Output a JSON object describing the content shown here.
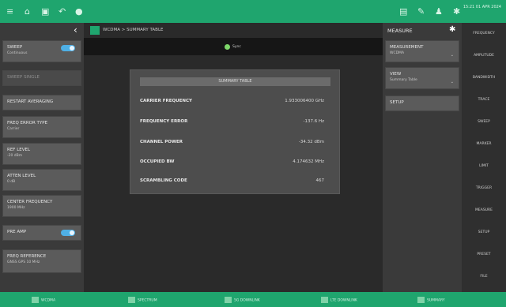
{
  "topbar": {
    "icons": [
      "menu-icon",
      "home-icon",
      "save-icon",
      "undo-icon",
      "pin-icon"
    ],
    "right_icons": [
      "screen-icon",
      "tools-icon",
      "user-icon",
      "gear-icon"
    ],
    "clock": "15:21 01 APR 2024"
  },
  "left_panel": {
    "collapse_icon": "chevron-left-icon",
    "items": [
      {
        "label": "SWEEP",
        "sub": "Continuous",
        "toggle": true
      },
      {
        "label": "SWEEP SINGLE",
        "sub": ""
      },
      {
        "label": "RESTART AVERAGING",
        "sub": ""
      },
      {
        "label": "FREQ ERROR TYPE",
        "sub": "Carrier"
      },
      {
        "label": "REF LEVEL",
        "sub": "-20 dBm"
      },
      {
        "label": "ATTEN LEVEL",
        "sub": "0 dB"
      },
      {
        "label": "CENTER FREQUENCY",
        "sub": "1900 MHz"
      },
      {
        "label": "PRE AMP",
        "sub": "",
        "toggle": true
      },
      {
        "label": "FREQ REFERENCE",
        "sub": "GNSS GPS 10 MHz"
      }
    ]
  },
  "center": {
    "title": "WCDMA > SUMMARY TABLE",
    "sync_text": "Sync",
    "summary": {
      "header": "SUMMARY TABLE",
      "rows": [
        {
          "label": "CARRIER FREQUENCY",
          "value": "1.933006400 GHz"
        },
        {
          "label": "FREQUENCY ERROR",
          "value": "-137.6 Hz"
        },
        {
          "label": "CHANNEL POWER",
          "value": "-34.32 dBm"
        },
        {
          "label": "OCCUPIED BW",
          "value": "4.174632 MHz"
        },
        {
          "label": "SCRAMBLING CODE",
          "value": "467"
        }
      ]
    }
  },
  "right_panel": {
    "title": "MEASURE",
    "measurement": {
      "label": "MEASUREMENT",
      "value": "WCDMA"
    },
    "view": {
      "label": "VIEW",
      "value": "Summary Table"
    },
    "setup_label": "SETUP"
  },
  "menu_strip": {
    "items": [
      "FREQUENCY",
      "AMPLITUDE",
      "BANDWIDTH",
      "TRACE",
      "SWEEP",
      "MARKER",
      "LIMIT",
      "TRIGGER",
      "MEASURE",
      "SETUP",
      "PRESET",
      "FILE"
    ]
  },
  "bottom_bar": {
    "items": [
      "WCDMA",
      "SPECTRUM",
      "5G DOWNLINK",
      "LTE DOWNLINK",
      "SUMMARY"
    ]
  },
  "colors": {
    "accent_green": "#1fa56e",
    "toggle_blue": "#4fb0e6",
    "sync_dot": "#7ed86a"
  }
}
